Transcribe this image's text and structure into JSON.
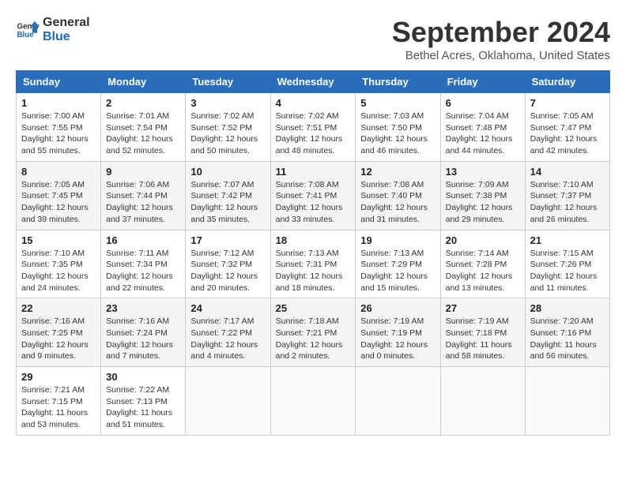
{
  "header": {
    "logo_general": "General",
    "logo_blue": "Blue",
    "month_title": "September 2024",
    "location": "Bethel Acres, Oklahoma, United States"
  },
  "days_of_week": [
    "Sunday",
    "Monday",
    "Tuesday",
    "Wednesday",
    "Thursday",
    "Friday",
    "Saturday"
  ],
  "weeks": [
    [
      {
        "day": "1",
        "sunrise": "Sunrise: 7:00 AM",
        "sunset": "Sunset: 7:55 PM",
        "daylight": "Daylight: 12 hours and 55 minutes."
      },
      {
        "day": "2",
        "sunrise": "Sunrise: 7:01 AM",
        "sunset": "Sunset: 7:54 PM",
        "daylight": "Daylight: 12 hours and 52 minutes."
      },
      {
        "day": "3",
        "sunrise": "Sunrise: 7:02 AM",
        "sunset": "Sunset: 7:52 PM",
        "daylight": "Daylight: 12 hours and 50 minutes."
      },
      {
        "day": "4",
        "sunrise": "Sunrise: 7:02 AM",
        "sunset": "Sunset: 7:51 PM",
        "daylight": "Daylight: 12 hours and 48 minutes."
      },
      {
        "day": "5",
        "sunrise": "Sunrise: 7:03 AM",
        "sunset": "Sunset: 7:50 PM",
        "daylight": "Daylight: 12 hours and 46 minutes."
      },
      {
        "day": "6",
        "sunrise": "Sunrise: 7:04 AM",
        "sunset": "Sunset: 7:48 PM",
        "daylight": "Daylight: 12 hours and 44 minutes."
      },
      {
        "day": "7",
        "sunrise": "Sunrise: 7:05 AM",
        "sunset": "Sunset: 7:47 PM",
        "daylight": "Daylight: 12 hours and 42 minutes."
      }
    ],
    [
      {
        "day": "8",
        "sunrise": "Sunrise: 7:05 AM",
        "sunset": "Sunset: 7:45 PM",
        "daylight": "Daylight: 12 hours and 39 minutes."
      },
      {
        "day": "9",
        "sunrise": "Sunrise: 7:06 AM",
        "sunset": "Sunset: 7:44 PM",
        "daylight": "Daylight: 12 hours and 37 minutes."
      },
      {
        "day": "10",
        "sunrise": "Sunrise: 7:07 AM",
        "sunset": "Sunset: 7:42 PM",
        "daylight": "Daylight: 12 hours and 35 minutes."
      },
      {
        "day": "11",
        "sunrise": "Sunrise: 7:08 AM",
        "sunset": "Sunset: 7:41 PM",
        "daylight": "Daylight: 12 hours and 33 minutes."
      },
      {
        "day": "12",
        "sunrise": "Sunrise: 7:08 AM",
        "sunset": "Sunset: 7:40 PM",
        "daylight": "Daylight: 12 hours and 31 minutes."
      },
      {
        "day": "13",
        "sunrise": "Sunrise: 7:09 AM",
        "sunset": "Sunset: 7:38 PM",
        "daylight": "Daylight: 12 hours and 29 minutes."
      },
      {
        "day": "14",
        "sunrise": "Sunrise: 7:10 AM",
        "sunset": "Sunset: 7:37 PM",
        "daylight": "Daylight: 12 hours and 26 minutes."
      }
    ],
    [
      {
        "day": "15",
        "sunrise": "Sunrise: 7:10 AM",
        "sunset": "Sunset: 7:35 PM",
        "daylight": "Daylight: 12 hours and 24 minutes."
      },
      {
        "day": "16",
        "sunrise": "Sunrise: 7:11 AM",
        "sunset": "Sunset: 7:34 PM",
        "daylight": "Daylight: 12 hours and 22 minutes."
      },
      {
        "day": "17",
        "sunrise": "Sunrise: 7:12 AM",
        "sunset": "Sunset: 7:32 PM",
        "daylight": "Daylight: 12 hours and 20 minutes."
      },
      {
        "day": "18",
        "sunrise": "Sunrise: 7:13 AM",
        "sunset": "Sunset: 7:31 PM",
        "daylight": "Daylight: 12 hours and 18 minutes."
      },
      {
        "day": "19",
        "sunrise": "Sunrise: 7:13 AM",
        "sunset": "Sunset: 7:29 PM",
        "daylight": "Daylight: 12 hours and 15 minutes."
      },
      {
        "day": "20",
        "sunrise": "Sunrise: 7:14 AM",
        "sunset": "Sunset: 7:28 PM",
        "daylight": "Daylight: 12 hours and 13 minutes."
      },
      {
        "day": "21",
        "sunrise": "Sunrise: 7:15 AM",
        "sunset": "Sunset: 7:26 PM",
        "daylight": "Daylight: 12 hours and 11 minutes."
      }
    ],
    [
      {
        "day": "22",
        "sunrise": "Sunrise: 7:16 AM",
        "sunset": "Sunset: 7:25 PM",
        "daylight": "Daylight: 12 hours and 9 minutes."
      },
      {
        "day": "23",
        "sunrise": "Sunrise: 7:16 AM",
        "sunset": "Sunset: 7:24 PM",
        "daylight": "Daylight: 12 hours and 7 minutes."
      },
      {
        "day": "24",
        "sunrise": "Sunrise: 7:17 AM",
        "sunset": "Sunset: 7:22 PM",
        "daylight": "Daylight: 12 hours and 4 minutes."
      },
      {
        "day": "25",
        "sunrise": "Sunrise: 7:18 AM",
        "sunset": "Sunset: 7:21 PM",
        "daylight": "Daylight: 12 hours and 2 minutes."
      },
      {
        "day": "26",
        "sunrise": "Sunrise: 7:19 AM",
        "sunset": "Sunset: 7:19 PM",
        "daylight": "Daylight: 12 hours and 0 minutes."
      },
      {
        "day": "27",
        "sunrise": "Sunrise: 7:19 AM",
        "sunset": "Sunset: 7:18 PM",
        "daylight": "Daylight: 11 hours and 58 minutes."
      },
      {
        "day": "28",
        "sunrise": "Sunrise: 7:20 AM",
        "sunset": "Sunset: 7:16 PM",
        "daylight": "Daylight: 11 hours and 56 minutes."
      }
    ],
    [
      {
        "day": "29",
        "sunrise": "Sunrise: 7:21 AM",
        "sunset": "Sunset: 7:15 PM",
        "daylight": "Daylight: 11 hours and 53 minutes."
      },
      {
        "day": "30",
        "sunrise": "Sunrise: 7:22 AM",
        "sunset": "Sunset: 7:13 PM",
        "daylight": "Daylight: 11 hours and 51 minutes."
      },
      null,
      null,
      null,
      null,
      null
    ]
  ]
}
